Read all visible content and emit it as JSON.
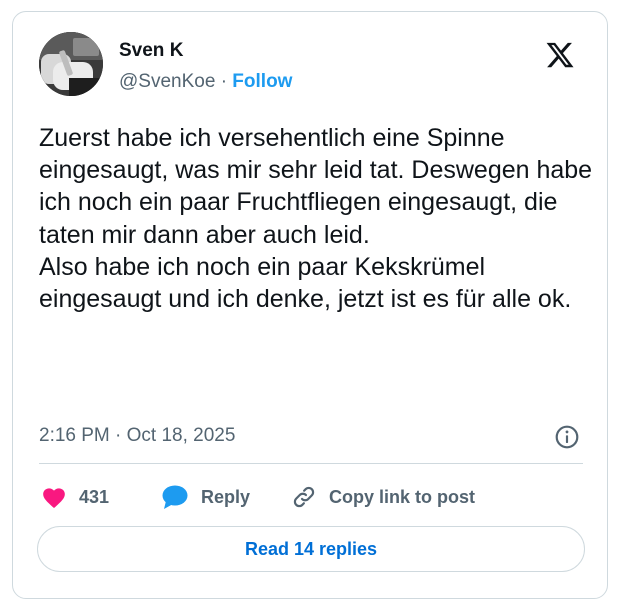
{
  "author": {
    "name": "Sven K",
    "handle": "@SvenKoe",
    "separator": "·",
    "follow_label": "Follow"
  },
  "brand": {
    "icon": "x-logo-icon"
  },
  "tweet": {
    "paragraphs": [
      "Zuerst habe ich versehentlich eine Spinne eingesaugt, was mir sehr leid tat. Deswegen habe ich noch ein paar Fruchtfliegen eingesaugt, die taten mir dann aber auch leid.",
      "Also habe ich noch ein paar Kekskrümel eingesaugt und ich denke, jetzt ist es für alle ok."
    ],
    "timestamp": "2:16 PM · Oct 18, 2025"
  },
  "actions": {
    "like_count": "431",
    "reply_label": "Reply",
    "copy_label": "Copy link to post",
    "read_replies_label": "Read 14 replies"
  },
  "colors": {
    "accent": "#1d9bf0",
    "like": "#f91880",
    "text": "#0f1419",
    "secondary": "#536471",
    "border": "#cfd9de"
  },
  "icons": {
    "like": "heart-icon",
    "reply": "speech-bubble-icon",
    "copy": "link-icon",
    "info": "info-icon"
  }
}
